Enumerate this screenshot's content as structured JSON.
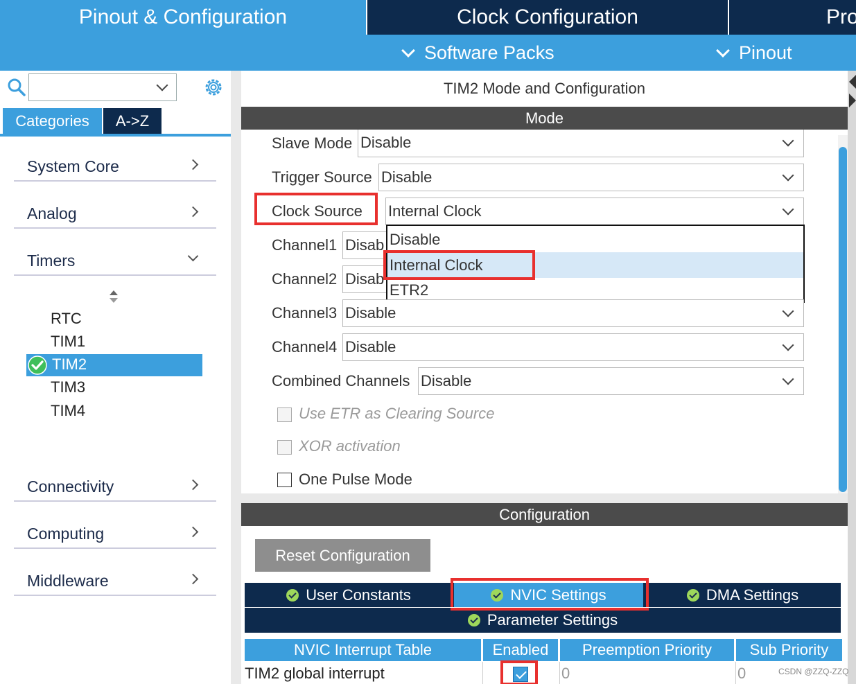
{
  "top_tabs": {
    "pinout": "Pinout & Configuration",
    "clock": "Clock Configuration",
    "project": "Pro"
  },
  "subbar": {
    "software_packs": "Software Packs",
    "pinout": "Pinout"
  },
  "left": {
    "search_placeholder": "",
    "tabs": {
      "categories": "Categories",
      "az": "A->Z"
    },
    "categories": [
      {
        "label": "System Core"
      },
      {
        "label": "Analog"
      },
      {
        "label": "Timers"
      },
      {
        "label": "Connectivity"
      },
      {
        "label": "Computing"
      },
      {
        "label": "Middleware"
      }
    ],
    "timers": [
      "RTC",
      "TIM1",
      "TIM2",
      "TIM3",
      "TIM4"
    ],
    "selected_timer": "TIM2"
  },
  "main": {
    "title": "TIM2 Mode and Configuration",
    "mode_header": "Mode",
    "fields": {
      "slave_mode": {
        "label": "Slave Mode",
        "value": "Disable"
      },
      "trigger_source": {
        "label": "Trigger Source",
        "value": "Disable"
      },
      "clock_source": {
        "label": "Clock Source",
        "value": "Internal Clock"
      },
      "channel1": {
        "label": "Channel1",
        "value": "Disab"
      },
      "channel2": {
        "label": "Channel2",
        "value": "Disab"
      },
      "channel3": {
        "label": "Channel3",
        "value": "Disable"
      },
      "channel4": {
        "label": "Channel4",
        "value": "Disable"
      },
      "combined": {
        "label": "Combined Channels",
        "value": "Disable"
      }
    },
    "dropdown_options": [
      "Disable",
      "Internal Clock",
      "ETR2"
    ],
    "checkboxes": {
      "etr": "Use ETR as Clearing Source",
      "xor": "XOR activation",
      "one_pulse": "One Pulse Mode"
    },
    "config_header": "Configuration",
    "reset_button": "Reset Configuration",
    "config_tabs": {
      "user_constants": "User Constants",
      "nvic": "NVIC Settings",
      "dma": "DMA Settings",
      "parameter": "Parameter Settings"
    },
    "nvic_table": {
      "headers": [
        "NVIC Interrupt Table",
        "Enabled",
        "Preemption Priority",
        "Sub Priority"
      ],
      "rows": [
        {
          "name": "TIM2 global interrupt",
          "enabled": true,
          "preemption": "0",
          "sub": "0"
        }
      ]
    }
  },
  "watermark": "CSDN @ZZQ-ZZQ",
  "colors": {
    "accent_blue": "#3c9fdd",
    "navy": "#0d2a4d",
    "highlight_red": "#e8302e",
    "dark_header": "#4b4b4b"
  }
}
